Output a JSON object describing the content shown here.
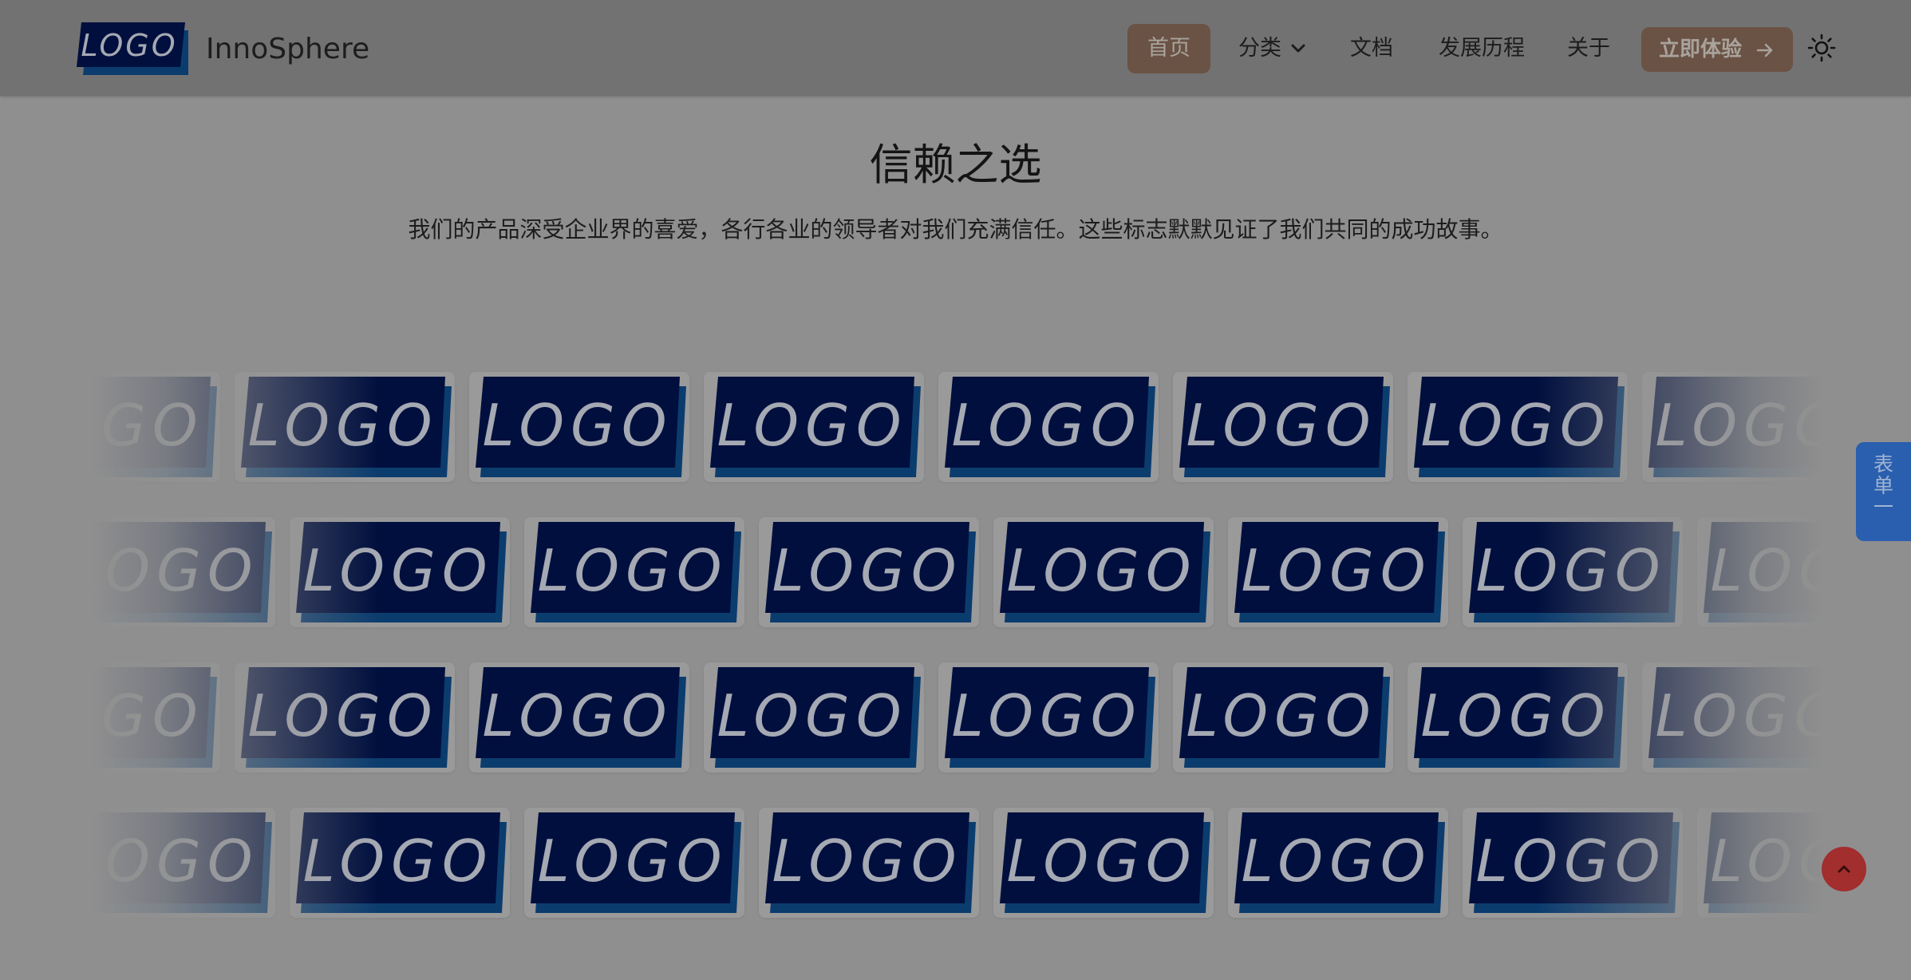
{
  "header": {
    "logo_text": "LOGO",
    "brand_name": "InnoSphere",
    "nav": {
      "home": "首页",
      "category": "分类",
      "docs": "文档",
      "history": "发展历程",
      "about": "关于"
    },
    "cta_label": "立即体验",
    "icons": {
      "category_dropdown": "chevron-down-icon",
      "cta": "arrow-right-icon",
      "theme": "sun-icon"
    }
  },
  "hero": {
    "title": "信赖之选",
    "subtitle": "我们的产品深受企业界的喜爱，各行各业的领导者对我们充满信任。这些标志默默见证了我们共同的成功故事。"
  },
  "logo_wall": {
    "logo_text": "LOGO",
    "rows": 4,
    "logos_per_row": [
      8,
      8,
      8,
      8
    ]
  },
  "side_tab": {
    "chars": [
      "表",
      "单",
      "一"
    ]
  },
  "back_to_top": {
    "icon": "chevron-up-icon"
  },
  "colors": {
    "overlay_bg": "#8f8f8f",
    "header_bg": "#727272",
    "accent_button": "#6a5245",
    "logo_navy": "#000f3e",
    "logo_shadow": "#0b3c6e",
    "side_tab": "#2a5eae",
    "back_to_top": "#a22e2e"
  }
}
